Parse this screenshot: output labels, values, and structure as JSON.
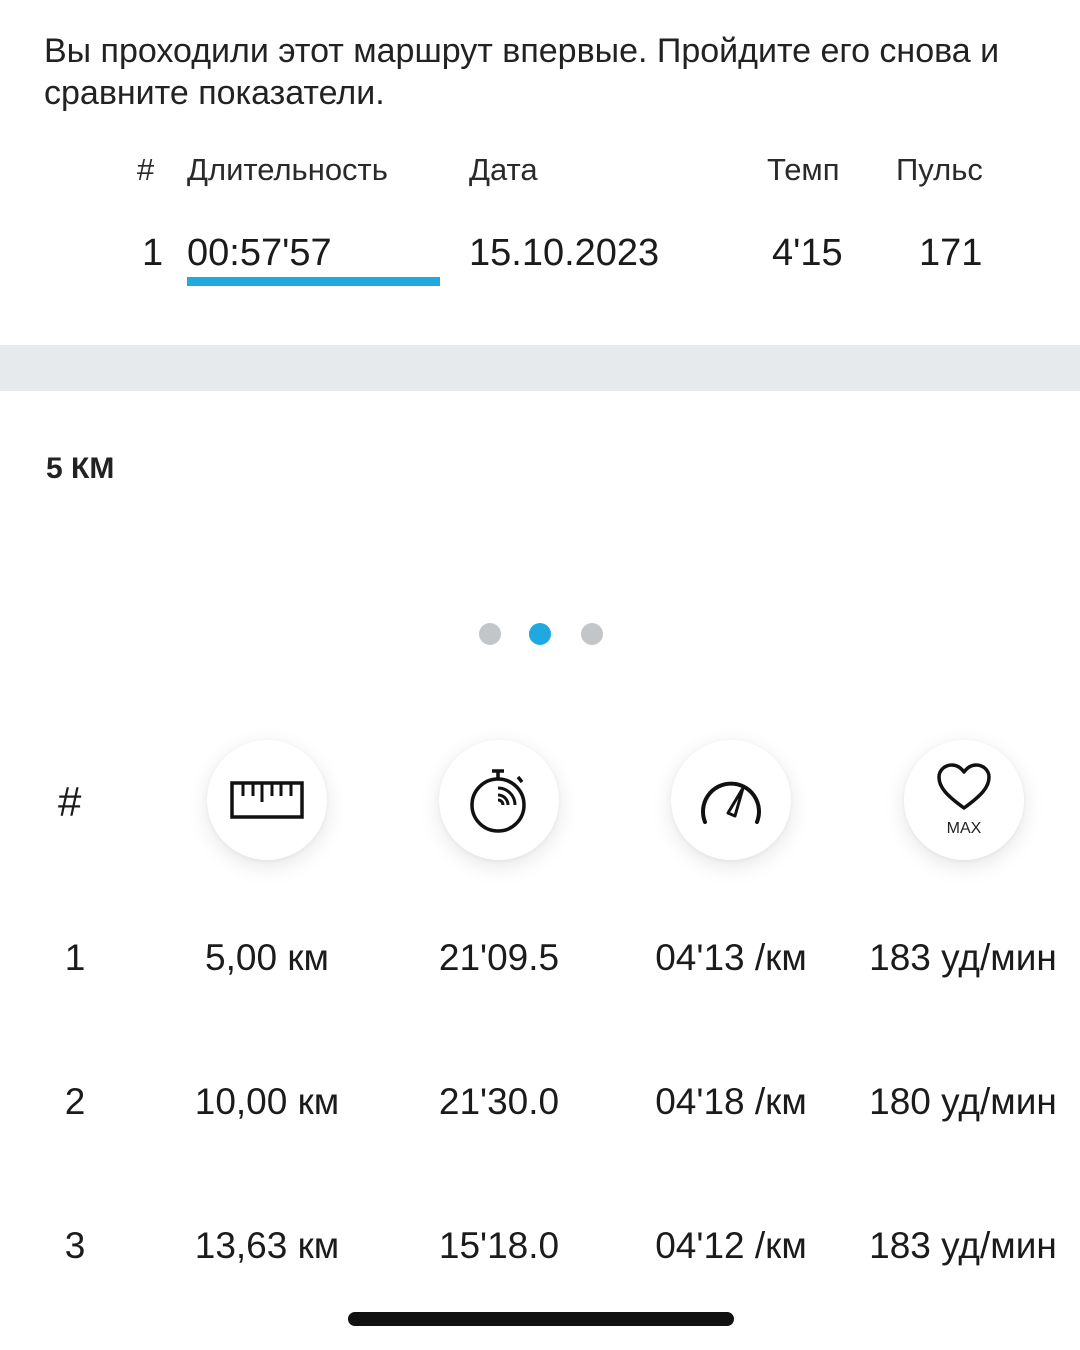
{
  "intro_text": "Вы проходили этот маршрут впервые. Пройдите его снова и сравните показатели.",
  "attempts_table": {
    "headers": {
      "num": "#",
      "duration": "Длительность",
      "date": "Дата",
      "pace": "Темп",
      "pulse": "Пульс"
    },
    "rows": [
      {
        "num": "1",
        "duration": "00:57'57",
        "date": "15.10.2023",
        "pace": "4'15",
        "pulse": "171"
      }
    ]
  },
  "section_title": "5 КМ",
  "pager": {
    "count": 3,
    "active_index": 1
  },
  "splits": {
    "header_num": "#",
    "icons": [
      "ruler-icon",
      "stopwatch-icon",
      "speedometer-icon",
      "heart-icon"
    ],
    "max_label": "MAX",
    "rows": [
      {
        "num": "1",
        "distance": "5,00 км",
        "time": "21'09.5",
        "pace": "04'13 /км",
        "hr": "183 уд/мин"
      },
      {
        "num": "2",
        "distance": "10,00 км",
        "time": "21'30.0",
        "pace": "04'18 /км",
        "hr": "180 уд/мин"
      },
      {
        "num": "3",
        "distance": "13,63 км",
        "time": "15'18.0",
        "pace": "04'12 /км",
        "hr": "183 уд/мин"
      }
    ]
  },
  "colors": {
    "accent": "#1fa9e0",
    "divider": "#e7eaec",
    "dot_inactive": "#c3c6c9"
  }
}
